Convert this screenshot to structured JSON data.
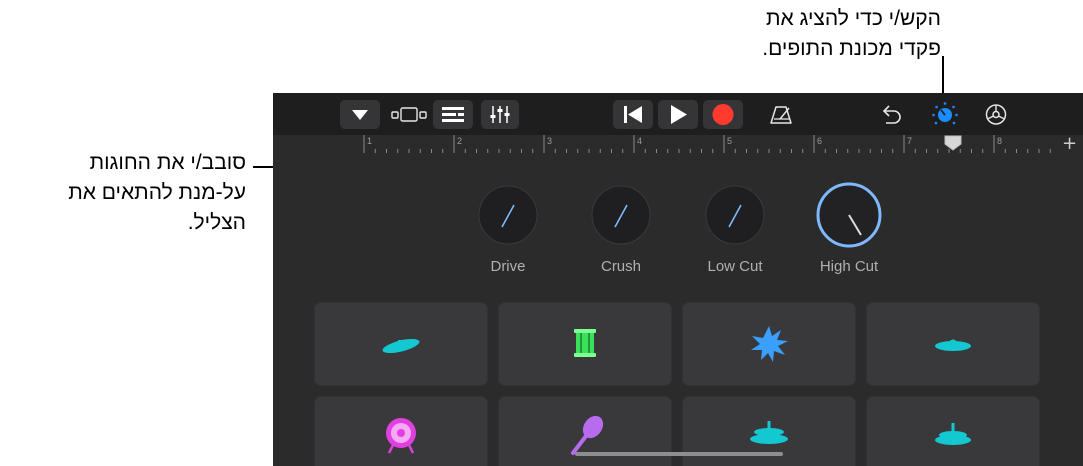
{
  "callouts": {
    "top": {
      "line1": "הקש/י כדי להציג את",
      "line2": "פקדי מכונת התופים."
    },
    "left": {
      "line1": "סובב/י את החוגות",
      "line2": "על-מנת להתאים את",
      "line3": "הצליל."
    }
  },
  "toolbar": {
    "icons": [
      "browser-dropdown-icon",
      "tracks-view-icon",
      "list-view-icon",
      "mixer-icon",
      "go-to-beginning-icon",
      "play-icon",
      "record-icon",
      "metronome-icon",
      "undo-icon",
      "drum-controls-icon",
      "settings-icon"
    ]
  },
  "ruler": {
    "marks": [
      "1",
      "2",
      "3",
      "4",
      "5",
      "6",
      "7",
      "8"
    ],
    "add_label": "+"
  },
  "knobs": [
    {
      "label": "Drive",
      "active": false
    },
    {
      "label": "Crush",
      "active": false
    },
    {
      "label": "Low Cut",
      "active": false
    },
    {
      "label": "High Cut",
      "active": true
    }
  ],
  "pads": [
    {
      "icon": "crash-cymbal-icon"
    },
    {
      "icon": "snare-drum-icon"
    },
    {
      "icon": "clap-burst-icon"
    },
    {
      "icon": "ride-cymbal-icon"
    },
    {
      "icon": "kick-drum-icon"
    },
    {
      "icon": "maraca-icon"
    },
    {
      "icon": "hihat-open-icon"
    },
    {
      "icon": "hihat-closed-icon"
    }
  ],
  "colors": {
    "accent": "#1a8cff",
    "record": "#ff3b30",
    "cyan": "#14c8d2",
    "green": "#3ae05a",
    "magenta": "#e040e0",
    "purple": "#b76cf0",
    "blue": "#3aa0ff"
  }
}
